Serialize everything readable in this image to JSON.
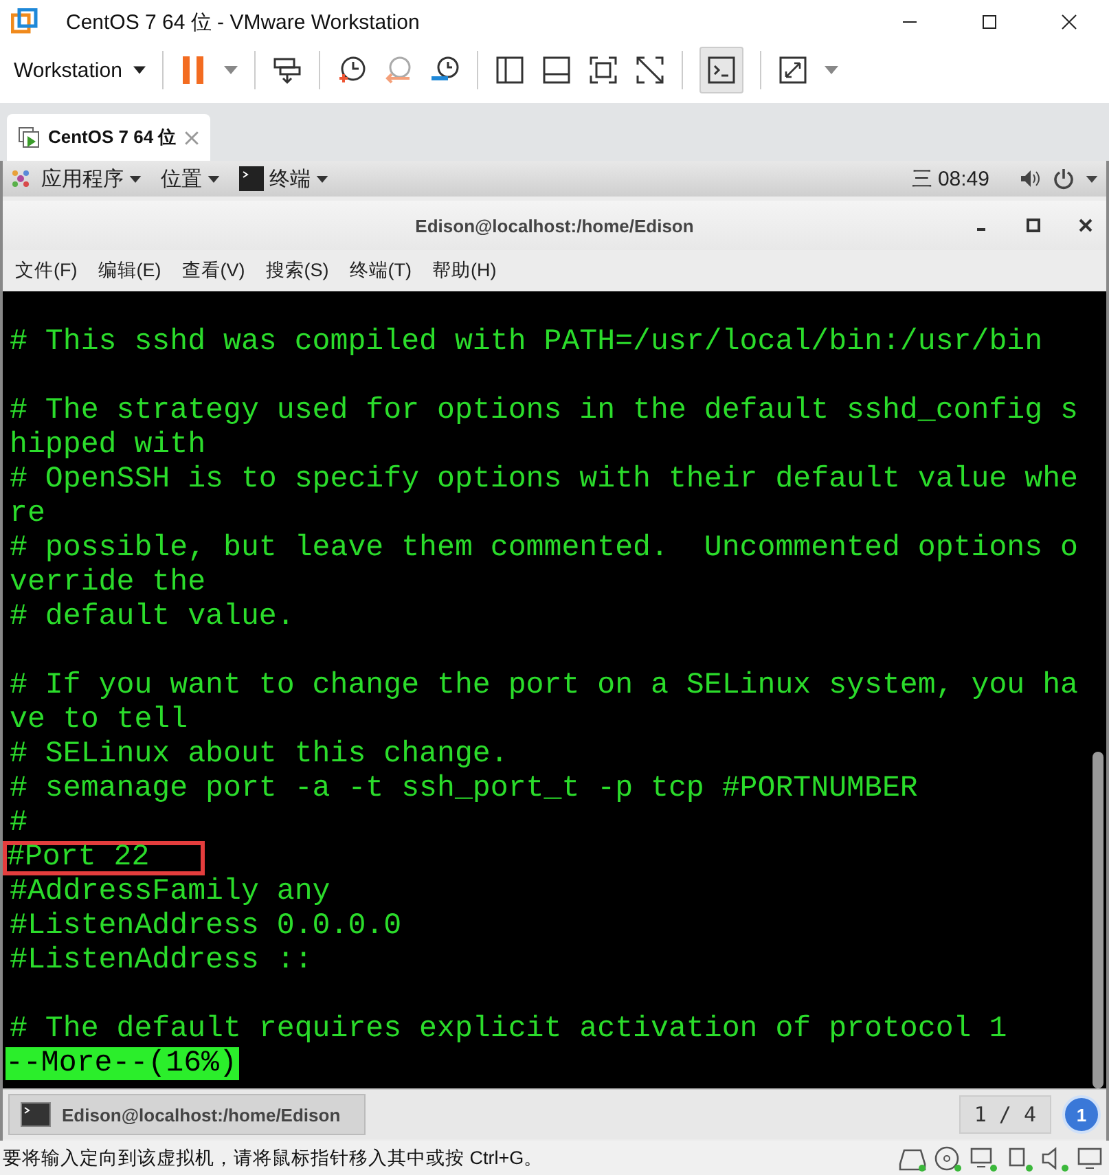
{
  "window": {
    "title": "CentOS 7 64 位 - VMware Workstation"
  },
  "toolbar": {
    "menu_label": "Workstation"
  },
  "vm_tabs": [
    {
      "label": "CentOS 7 64 位",
      "selected": true
    }
  ],
  "gnome_bar": {
    "menus": [
      "应用程序",
      "位置",
      "终端"
    ],
    "clock_day": "三",
    "clock_time": "08:49"
  },
  "terminal_window": {
    "title": "Edison@localhost:/home/Edison",
    "menu": [
      "文件(F)",
      "编辑(E)",
      "查看(V)",
      "搜索(S)",
      "终端(T)",
      "帮助(H)"
    ]
  },
  "terminal_lines": [
    {
      "kind": "blank",
      "highlighted": false
    },
    {
      "kind": "text",
      "text": "# This sshd was compiled with PATH=/usr/local/bin:/usr/bin",
      "highlighted": false
    },
    {
      "kind": "blank",
      "highlighted": false
    },
    {
      "kind": "text",
      "text": "# The strategy used for options in the default sshd_config s",
      "highlighted": false
    },
    {
      "kind": "text",
      "text": "hipped with",
      "highlighted": false
    },
    {
      "kind": "text",
      "text": "# OpenSSH is to specify options with their default value whe",
      "highlighted": false
    },
    {
      "kind": "text",
      "text": "re",
      "highlighted": false
    },
    {
      "kind": "text",
      "text": "# possible, but leave them commented.  Uncommented options o",
      "highlighted": false
    },
    {
      "kind": "text",
      "text": "verride the",
      "highlighted": false
    },
    {
      "kind": "text",
      "text": "# default value.",
      "highlighted": false
    },
    {
      "kind": "blank",
      "highlighted": false
    },
    {
      "kind": "text",
      "text": "# If you want to change the port on a SELinux system, you ha",
      "highlighted": false
    },
    {
      "kind": "text",
      "text": "ve to tell",
      "highlighted": false
    },
    {
      "kind": "text",
      "text": "# SELinux about this change.",
      "highlighted": false
    },
    {
      "kind": "text",
      "text": "# semanage port -a -t ssh_port_t -p tcp #PORTNUMBER",
      "highlighted": false
    },
    {
      "kind": "text",
      "text": "#",
      "highlighted": false
    },
    {
      "kind": "text",
      "text": "#Port 22",
      "highlighted": true
    },
    {
      "kind": "text",
      "text": "#AddressFamily any",
      "highlighted": false
    },
    {
      "kind": "text",
      "text": "#ListenAddress 0.0.0.0",
      "highlighted": false
    },
    {
      "kind": "text",
      "text": "#ListenAddress ::",
      "highlighted": false
    },
    {
      "kind": "blank",
      "highlighted": false
    },
    {
      "kind": "text",
      "text": "# The default requires explicit activation of protocol 1",
      "highlighted": false
    },
    {
      "kind": "status",
      "text": "--More--(16%)",
      "highlighted": false
    }
  ],
  "taskbar": {
    "items": [
      {
        "label": "Edison@localhost:/home/Edison",
        "selected": true
      }
    ],
    "workspace": "1 / 4",
    "badge": "1"
  },
  "status_bar": {
    "message": "要将输入定向到该虚拟机，请将鼠标指针移入其中或按 Ctrl+G。"
  }
}
